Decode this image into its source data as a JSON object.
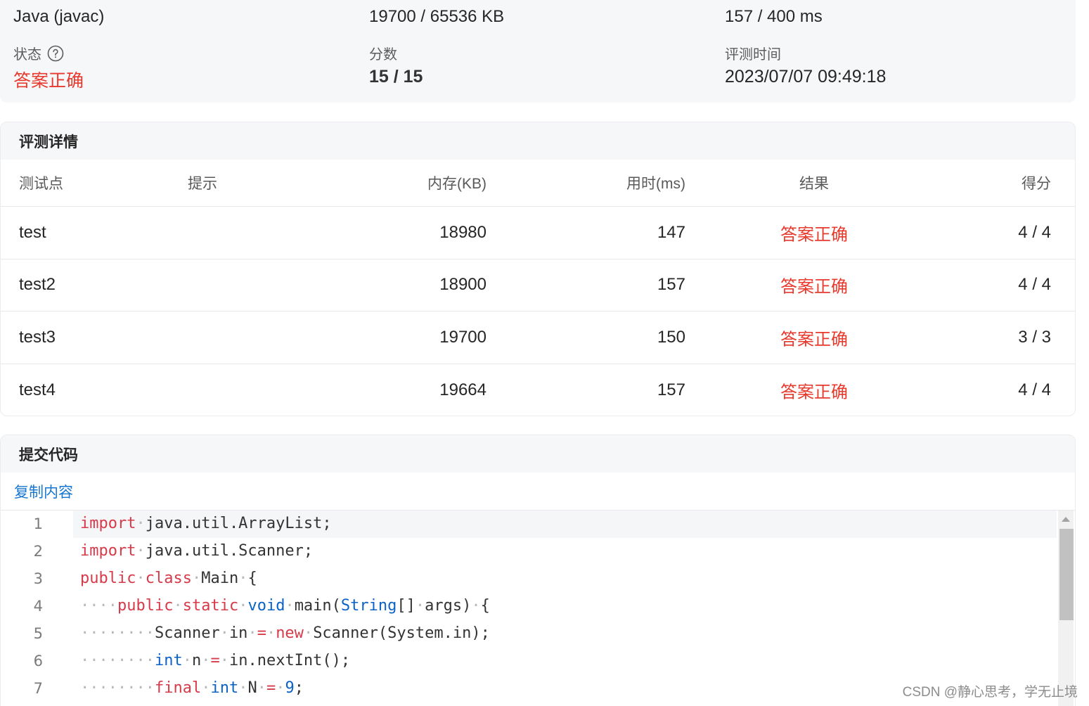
{
  "summary": {
    "language": "Java (javac)",
    "memory": "19700 / 65536 KB",
    "time": "157 / 400 ms",
    "status_label": "状态",
    "status_value": "答案正确",
    "score_label": "分数",
    "score_value": "15 / 15",
    "judge_time_label": "评测时间",
    "judge_time_value": "2023/07/07 09:49:18"
  },
  "details": {
    "title": "评测详情",
    "headers": {
      "case": "测试点",
      "hint": "提示",
      "memory": "内存(KB)",
      "time": "用时(ms)",
      "result": "结果",
      "score": "得分"
    },
    "rows": [
      {
        "case": "test",
        "hint": "",
        "memory": "18980",
        "time": "147",
        "result": "答案正确",
        "score": "4 / 4"
      },
      {
        "case": "test2",
        "hint": "",
        "memory": "18900",
        "time": "157",
        "result": "答案正确",
        "score": "4 / 4"
      },
      {
        "case": "test3",
        "hint": "",
        "memory": "19700",
        "time": "150",
        "result": "答案正确",
        "score": "3 / 3"
      },
      {
        "case": "test4",
        "hint": "",
        "memory": "19664",
        "time": "157",
        "result": "答案正确",
        "score": "4 / 4"
      }
    ]
  },
  "code": {
    "title": "提交代码",
    "copy_label": "复制内容",
    "lines": [
      {
        "n": "1",
        "text": "import java.util.ArrayList;"
      },
      {
        "n": "2",
        "text": "import java.util.Scanner;"
      },
      {
        "n": "3",
        "text": "public class Main {"
      },
      {
        "n": "4",
        "text": "    public static void main(String[] args) {"
      },
      {
        "n": "5",
        "text": "        Scanner in = new Scanner(System.in);"
      },
      {
        "n": "6",
        "text": "        int n = in.nextInt();"
      },
      {
        "n": "7",
        "text": "        final int N = 9;"
      }
    ]
  },
  "colors": {
    "accepted": "#e8392d",
    "link": "#1677d2",
    "keyword": "#d73a49",
    "type": "#0b62c7"
  },
  "watermark": "CSDN @静心思考，学无止境"
}
